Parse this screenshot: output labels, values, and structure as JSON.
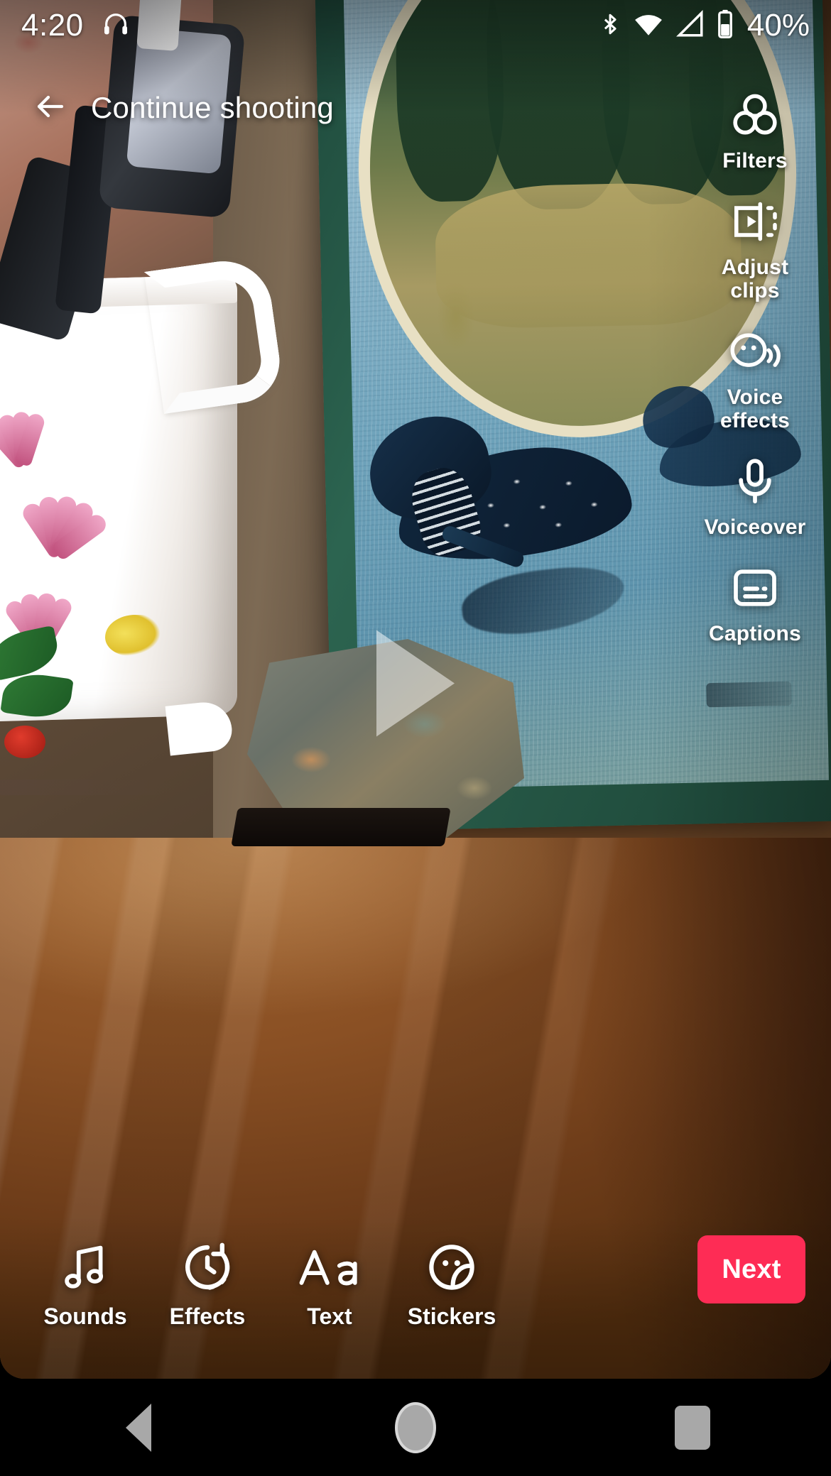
{
  "status_bar": {
    "time": "4:20",
    "headphone_icon": "headphone-icon",
    "bluetooth_icon": "bluetooth-icon",
    "wifi_icon": "wifi-icon",
    "signal_icon": "cellular-signal-icon",
    "battery_icon": "battery-icon",
    "battery_percent": "40%"
  },
  "top_bar": {
    "back_icon": "back-arrow-icon",
    "title": "Continue shooting"
  },
  "right_rail": {
    "items": [
      {
        "label": "Filters",
        "icon": "filters-icon"
      },
      {
        "label": "Adjust\nclips",
        "icon": "adjust-clips-icon",
        "line1": "Adjust",
        "line2": "clips"
      },
      {
        "label": "Voice\neffects",
        "icon": "voice-effects-icon",
        "line1": "Voice",
        "line2": "effects"
      },
      {
        "label": "Voiceover",
        "icon": "voiceover-microphone-icon"
      },
      {
        "label": "Captions",
        "icon": "captions-icon"
      }
    ]
  },
  "player": {
    "play_icon": "play-triangle-icon"
  },
  "bottom_bar": {
    "tools": [
      {
        "label": "Sounds",
        "icon": "music-note-icon"
      },
      {
        "label": "Effects",
        "icon": "timer-effects-icon"
      },
      {
        "label": "Text",
        "icon": "text-aa-icon"
      },
      {
        "label": "Stickers",
        "icon": "sticker-face-icon"
      }
    ],
    "next_label": "Next"
  },
  "nav_bar": {
    "back_icon": "android-back-icon",
    "home_icon": "android-home-icon",
    "recents_icon": "android-recents-icon"
  },
  "colors": {
    "accent": "#FE2C55",
    "text": "#FFFFFF",
    "nav_background": "#000000",
    "nav_icon": "#A8A8A8"
  }
}
